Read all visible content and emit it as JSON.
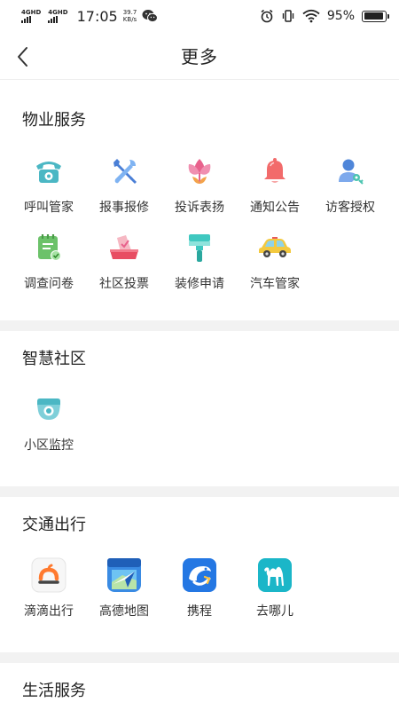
{
  "status_bar": {
    "network1": "4GHD",
    "network2": "4GHD",
    "time": "17:05",
    "speed_value": "39.7",
    "speed_unit": "KB/s",
    "battery_percent": "95%",
    "battery_level": 0.95
  },
  "header": {
    "title": "更多",
    "back_icon": "chevron-left-icon"
  },
  "sections": {
    "property": {
      "title": "物业服务",
      "items": [
        {
          "label": "呼叫管家",
          "icon": "telephone-icon"
        },
        {
          "label": "报事报修",
          "icon": "tools-icon"
        },
        {
          "label": "投诉表扬",
          "icon": "flower-icon"
        },
        {
          "label": "通知公告",
          "icon": "bell-icon"
        },
        {
          "label": "访客授权",
          "icon": "visitor-key-icon"
        },
        {
          "label": "调查问卷",
          "icon": "survey-icon"
        },
        {
          "label": "社区投票",
          "icon": "vote-box-icon"
        },
        {
          "label": "装修申请",
          "icon": "paint-roller-icon"
        },
        {
          "label": "汽车管家",
          "icon": "car-icon"
        }
      ]
    },
    "smart": {
      "title": "智慧社区",
      "items": [
        {
          "label": "小区监控",
          "icon": "camera-icon"
        }
      ]
    },
    "transport": {
      "title": "交通出行",
      "items": [
        {
          "label": "滴滴出行",
          "icon": "didi-icon"
        },
        {
          "label": "高德地图",
          "icon": "amap-icon"
        },
        {
          "label": "携程",
          "icon": "ctrip-icon"
        },
        {
          "label": "去哪儿",
          "icon": "qunar-icon"
        }
      ]
    },
    "life": {
      "title": "生活服务"
    }
  },
  "colors": {
    "teal": "#4bb7c4",
    "pink": "#e8618c",
    "red": "#f26b6b",
    "green": "#6cc26a",
    "didi_orange": "#ff7a2f",
    "ctrip_blue": "#2477e3",
    "qunar_cyan": "#1bb6c8",
    "gap_gray": "#f2f2f2"
  }
}
